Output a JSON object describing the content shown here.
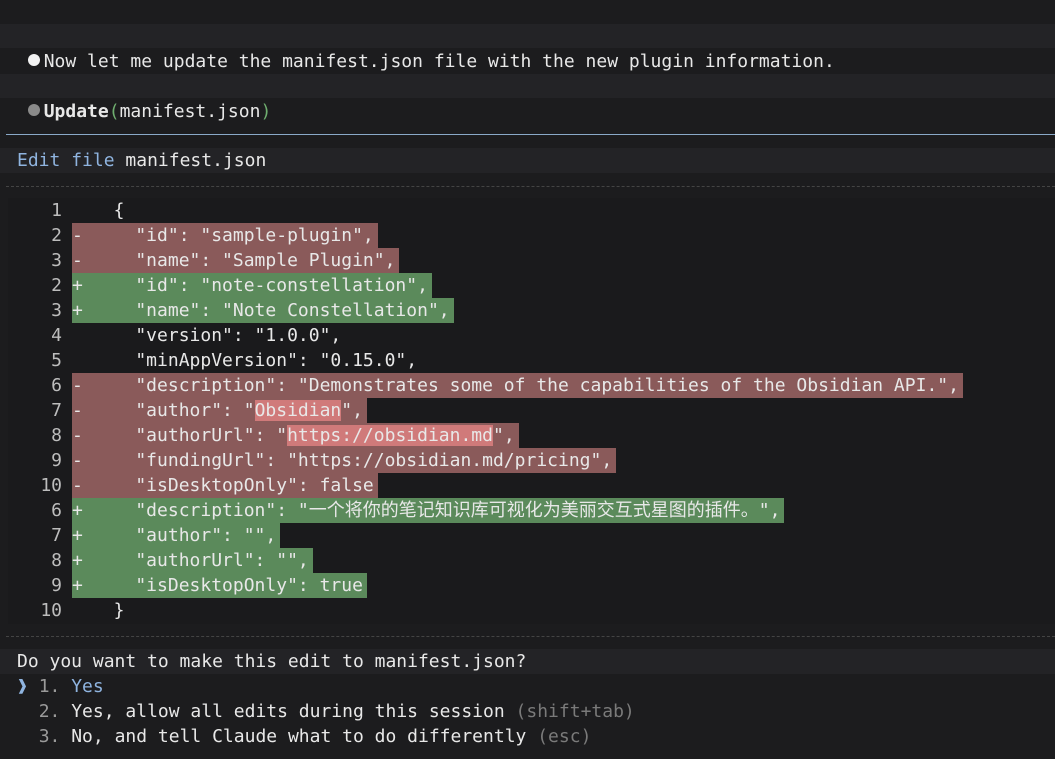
{
  "messages": [
    {
      "text": "Now let me update the manifest.json file with the new plugin information."
    },
    {
      "tool": "Update",
      "arg": "manifest.json",
      "open_paren": "(",
      "close_paren": ")"
    }
  ],
  "edit": {
    "kw1": "Edit",
    "kw2": "file",
    "filename": "manifest.json"
  },
  "diff": [
    {
      "n": "1",
      "type": "ctx",
      "pre": "  {",
      "hl": "",
      "post": ""
    },
    {
      "n": "2",
      "type": "del",
      "pre": "    \"id\": \"sample-plugin\",",
      "hl": "",
      "post": ""
    },
    {
      "n": "3",
      "type": "del",
      "pre": "    \"name\": \"Sample Plugin\",",
      "hl": "",
      "post": ""
    },
    {
      "n": "2",
      "type": "add",
      "pre": "    \"id\": \"note-constellation\",",
      "hl": "",
      "post": ""
    },
    {
      "n": "3",
      "type": "add",
      "pre": "    \"name\": \"Note Constellation\",",
      "hl": "",
      "post": ""
    },
    {
      "n": "4",
      "type": "ctx",
      "pre": "    \"version\": \"1.0.0\",",
      "hl": "",
      "post": ""
    },
    {
      "n": "5",
      "type": "ctx",
      "pre": "    \"minAppVersion\": \"0.15.0\",",
      "hl": "",
      "post": ""
    },
    {
      "n": "6",
      "type": "del",
      "pre": "    \"description\": \"Demonstrates some of the capabilities of the Obsidian API.\",",
      "hl": "",
      "post": ""
    },
    {
      "n": "7",
      "type": "del",
      "pre": "    \"author\": \"",
      "hl": "Obsidian",
      "post": "\","
    },
    {
      "n": "8",
      "type": "del",
      "pre": "    \"authorUrl\": \"",
      "hl": "https://obsidian.md",
      "post": "\","
    },
    {
      "n": "9",
      "type": "del",
      "pre": "    \"fundingUrl\": \"https://obsidian.md/pricing\",",
      "hl": "",
      "post": ""
    },
    {
      "n": "10",
      "type": "del",
      "pre": "    \"isDesktopOnly\": false",
      "hl": "",
      "post": ""
    },
    {
      "n": "6",
      "type": "add",
      "pre": "    \"description\": \"一个将你的笔记知识库可视化为美丽交互式星图的插件。\",",
      "hl": "",
      "post": ""
    },
    {
      "n": "7",
      "type": "add",
      "pre": "    \"author\": \"\",",
      "hl": "",
      "post": ""
    },
    {
      "n": "8",
      "type": "add",
      "pre": "    \"authorUrl\": \"\",",
      "hl": "",
      "post": ""
    },
    {
      "n": "9",
      "type": "add",
      "pre": "    \"isDesktopOnly\": true",
      "hl": "",
      "post": ""
    },
    {
      "n": "10",
      "type": "ctx",
      "pre": "  }",
      "hl": "",
      "post": ""
    }
  ],
  "prompt": {
    "question": "Do you want to make this edit to manifest.json?",
    "cursor": "❱",
    "options": [
      {
        "num": "1.",
        "label": "Yes",
        "hint": ""
      },
      {
        "num": "2.",
        "label": "Yes, allow all edits during this session",
        "hint": "(shift+tab)"
      },
      {
        "num": "3.",
        "label": "No, and tell Claude what to do differently",
        "hint": "(esc)"
      }
    ]
  },
  "colors": {
    "deleted": "#8a5a5a",
    "added": "#5b8a5b",
    "highlight": "#d07a7a",
    "selection": "#8fb4e0"
  }
}
